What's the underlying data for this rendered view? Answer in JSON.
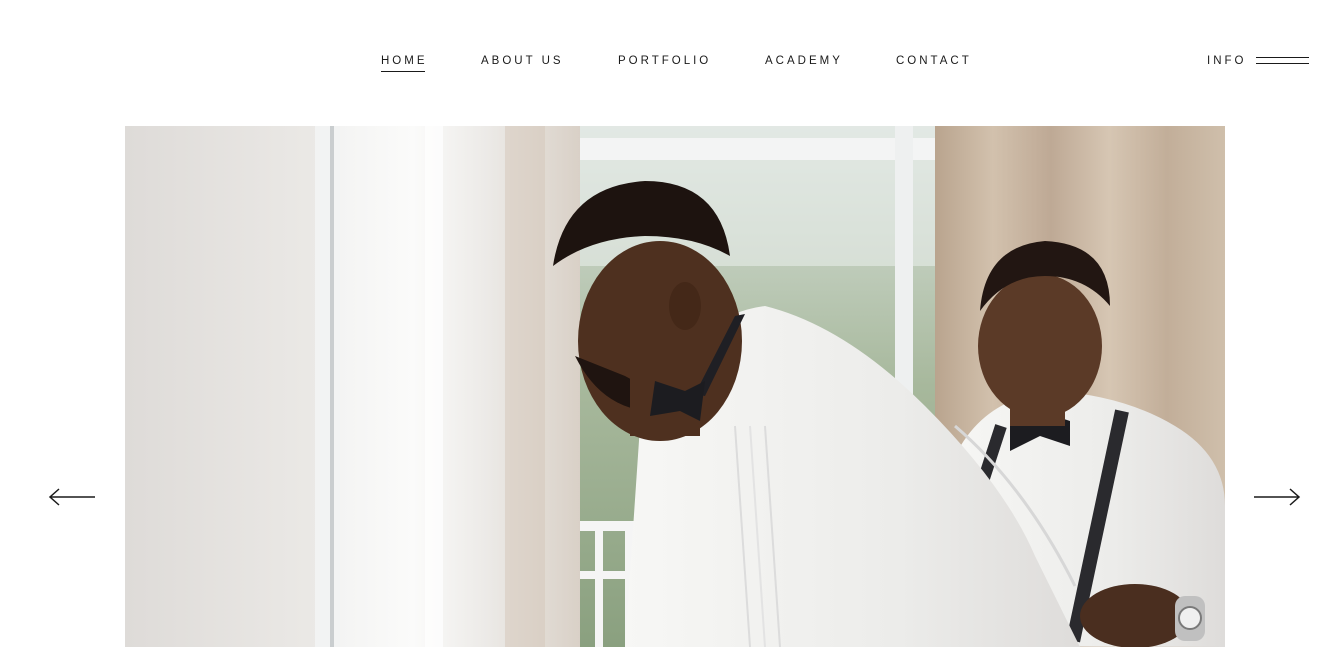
{
  "nav": {
    "items": [
      {
        "label": "HOME",
        "active": true
      },
      {
        "label": "ABOUT US",
        "active": false
      },
      {
        "label": "PORTFOLIO",
        "active": false
      },
      {
        "label": "ACADEMY",
        "active": false
      },
      {
        "label": "CONTACT",
        "active": false
      }
    ]
  },
  "header": {
    "info_label": "INFO",
    "menu_icon": "hamburger-icon"
  },
  "slider": {
    "prev_icon": "arrow-left-icon",
    "next_icon": "arrow-right-icon",
    "current_slide": {
      "icon": "photo",
      "colors": {
        "wall": "#e3e0dd",
        "curtain": "#c7b39e",
        "shirt": "#f5f4f2",
        "skin": "#5a3a28",
        "bowtie": "#1c1c20",
        "sash": "#c8102e"
      }
    }
  }
}
